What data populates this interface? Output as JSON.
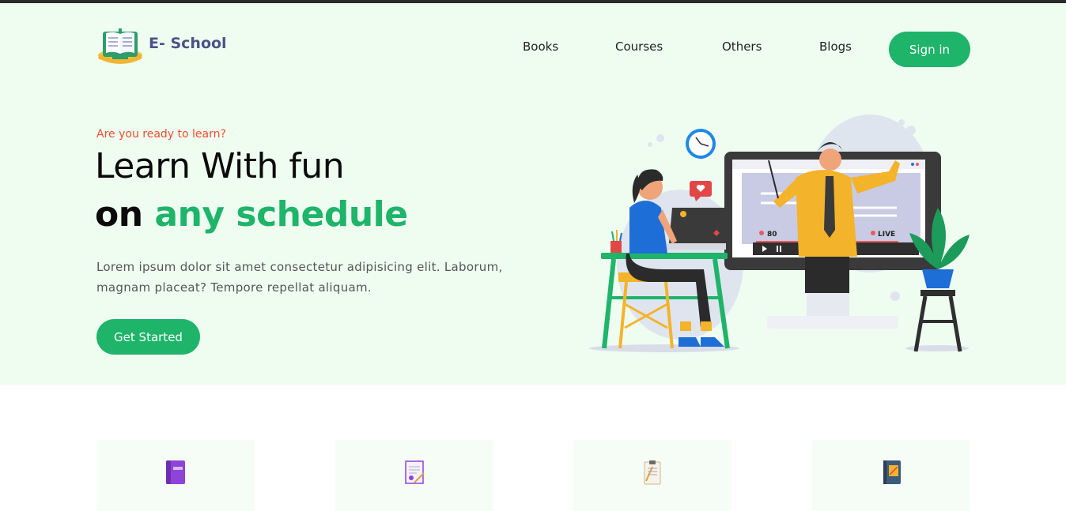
{
  "brand": {
    "name": "E- School"
  },
  "nav": {
    "items": [
      {
        "label": "Books"
      },
      {
        "label": "Courses"
      },
      {
        "label": "Others"
      },
      {
        "label": "Blogs"
      }
    ],
    "signin_label": "Sign in"
  },
  "hero": {
    "eyebrow": "Are you ready to learn?",
    "title_line1": "Learn With fun",
    "title_line2_prefix": "on ",
    "title_line2_accent": "any schedule",
    "description": "Lorem ipsum dolor sit amet consectetur adipisicing elit. Laborum, magnam placeat? Tempore repellat aliquam.",
    "cta_label": "Get Started",
    "illustration": {
      "viewer_count": "80",
      "live_label": "LIVE"
    }
  },
  "features": {
    "cards": [
      {
        "icon": "book-icon"
      },
      {
        "icon": "certificate-icon"
      },
      {
        "icon": "notepad-icon"
      },
      {
        "icon": "notebook-icon"
      }
    ]
  },
  "colors": {
    "accent": "#1eb46a",
    "hero_bg": "#effdf1",
    "eyebrow": "#ee4d2d",
    "brand_text": "#4a5287"
  }
}
